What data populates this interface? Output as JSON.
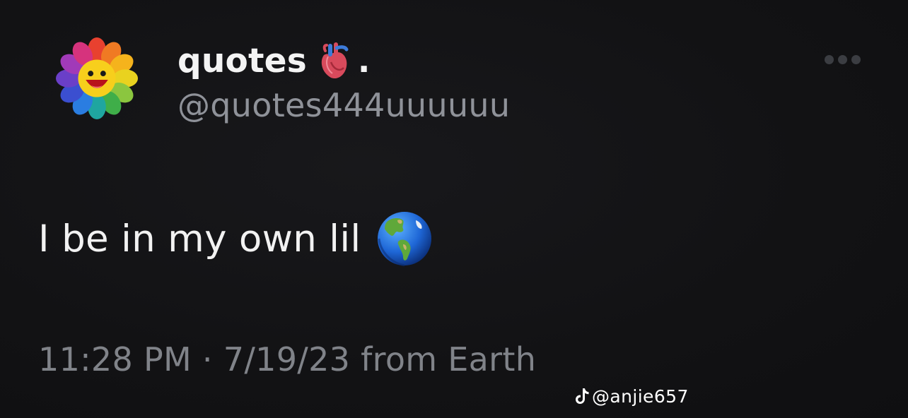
{
  "post": {
    "author": {
      "display_name": "quotes",
      "name_suffix": ".",
      "name_emoji": "anatomical-heart-icon",
      "handle": "@quotes444uuuuuu",
      "avatar": "rainbow-flower-avatar"
    },
    "text": "I be in my own lil",
    "text_emoji": "globe-americas-icon",
    "timestamp": "11:28 PM · 7/19/23 from Earth",
    "menu_icon": "more-options-icon"
  },
  "watermark": {
    "icon": "tiktok-icon",
    "text": "@anjie657"
  },
  "colors": {
    "background": "#121214",
    "primary_text": "#f4f4f4",
    "secondary_text": "#8f9299"
  }
}
